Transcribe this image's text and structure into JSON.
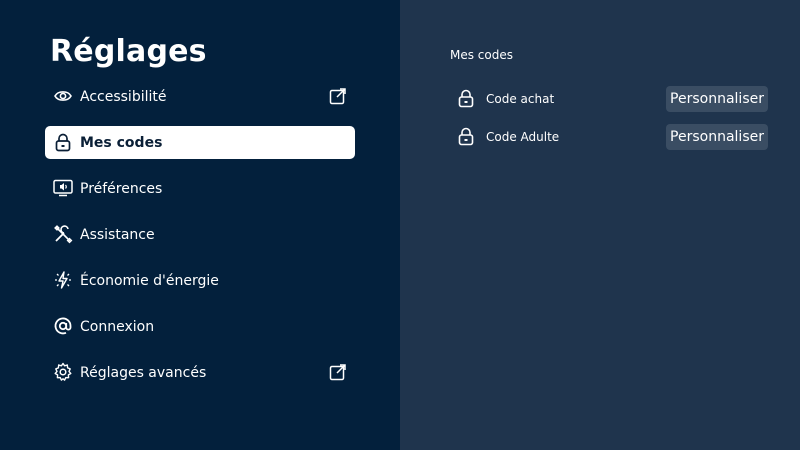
{
  "page": {
    "title": "Réglages"
  },
  "menu": {
    "items": [
      {
        "label": "Accessibilité",
        "icon": "eye-icon",
        "external": true
      },
      {
        "label": "Mes codes",
        "icon": "lock-icon",
        "selected": true
      },
      {
        "label": "Préférences",
        "icon": "tv-sound-icon"
      },
      {
        "label": "Assistance",
        "icon": "tools-icon"
      },
      {
        "label": "Économie d'énergie",
        "icon": "energy-icon"
      },
      {
        "label": "Connexion",
        "icon": "at-icon"
      },
      {
        "label": "Réglages avancés",
        "icon": "gear-icon",
        "external": true
      }
    ]
  },
  "detail": {
    "section_title": "Mes codes",
    "codes": [
      {
        "label": "Code achat",
        "button": "Personnaliser",
        "icon": "lock-icon"
      },
      {
        "label": "Code Adulte",
        "button": "Personnaliser",
        "icon": "lock-icon"
      }
    ]
  },
  "colors": {
    "left_bg": "#03203c",
    "right_bg": "#1f344d",
    "selected_bg": "#ffffff",
    "button_bg": "#3a4d63",
    "text": "#ffffff"
  }
}
